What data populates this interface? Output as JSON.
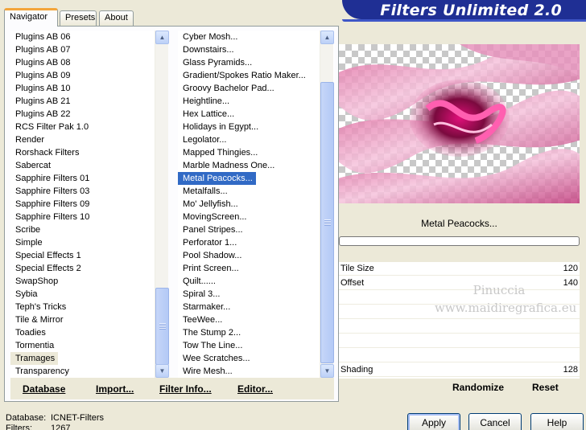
{
  "tabs": [
    "Navigator",
    "Presets",
    "About"
  ],
  "title": "Filters Unlimited 2.0",
  "left_list": [
    "Plugins AB 06",
    "Plugins AB 07",
    "Plugins AB 08",
    "Plugins AB 09",
    "Plugins AB 10",
    "Plugins AB 21",
    "Plugins AB 22",
    "RCS Filter Pak 1.0",
    "Render",
    "Rorshack Filters",
    "Sabercat",
    "Sapphire Filters 01",
    "Sapphire Filters 03",
    "Sapphire Filters 09",
    "Sapphire Filters 10",
    "Scribe",
    "Simple",
    "Special Effects 1",
    "Special Effects 2",
    "SwapShop",
    "Sybia",
    "Teph's Tricks",
    "Tile & Mirror",
    "Toadies",
    "Tormentia",
    "Tramages",
    "Transparency"
  ],
  "left_list_highlight": "Tramages",
  "right_list": [
    "Cyber Mosh...",
    "Downstairs...",
    "Glass Pyramids...",
    "Gradient/Spokes Ratio Maker...",
    "Groovy Bachelor Pad...",
    "Heightline...",
    "Hex Lattice...",
    "Holidays in Egypt...",
    "Legolator...",
    "Mapped Thingies...",
    "Marble Madness One...",
    "Metal Peacocks...",
    "Metalfalls...",
    "Mo' Jellyfish...",
    "MovingScreen...",
    "Panel Stripes...",
    "Perforator 1...",
    "Pool Shadow...",
    "Print Screen...",
    "Quilt......",
    "Spiral 3...",
    "Starmaker...",
    "TeeWee...",
    "The Stump 2...",
    "Tow The Line...",
    "Wee Scratches...",
    "Wire Mesh..."
  ],
  "right_list_selected": "Metal Peacocks...",
  "bottom_buttons": [
    "Database",
    "Import...",
    "Filter Info...",
    "Editor..."
  ],
  "filter_name": "Metal Peacocks...",
  "progress": 0,
  "params": [
    {
      "label": "Tile Size",
      "value": "120"
    },
    {
      "label": "Offset",
      "value": "140"
    },
    {
      "label": "Shading",
      "value": "128"
    }
  ],
  "watermark": [
    "Pinuccia",
    "www.maidiregrafica.eu"
  ],
  "action_buttons": [
    "Randomize",
    "Reset"
  ],
  "status": {
    "database_label": "Database:",
    "database_value": "ICNET-Filters",
    "filters_label": "Filters:",
    "filters_value": "1267"
  },
  "dialog_buttons": [
    "Apply",
    "Cancel",
    "Help"
  ],
  "colors": {
    "title_bg": "#1f2f94",
    "selection": "#316ac5",
    "tab_accent": "#f3a53b"
  }
}
